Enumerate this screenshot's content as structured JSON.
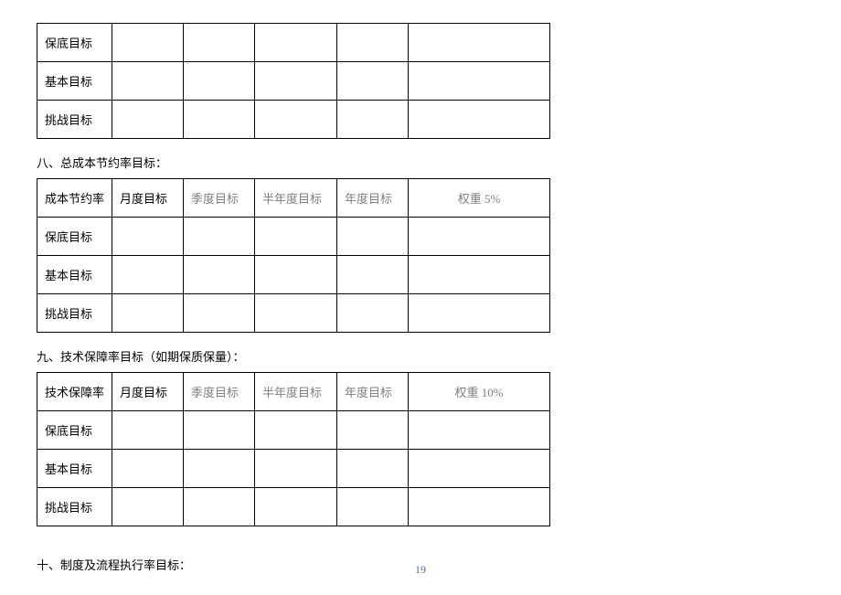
{
  "table1": {
    "rows": [
      {
        "label": "保底目标"
      },
      {
        "label": "基本目标"
      },
      {
        "label": "挑战目标"
      }
    ]
  },
  "section8": {
    "title": "八、总成本节约率目标：",
    "header": {
      "col1": "成本节约率",
      "col2": "月度目标",
      "col3": "季度目标",
      "col4": "半年度目标",
      "col5": "年度目标",
      "col6": "权重 5%"
    },
    "rows": [
      {
        "label": "保底目标"
      },
      {
        "label": "基本目标"
      },
      {
        "label": "挑战目标"
      }
    ]
  },
  "section9": {
    "title": "九、技术保障率目标（如期保质保量）：",
    "header": {
      "col1": "技术保障率",
      "col2": "月度目标",
      "col3": "季度目标",
      "col4": "半年度目标",
      "col5": "年度目标",
      "col6": "权重 10%"
    },
    "rows": [
      {
        "label": "保底目标"
      },
      {
        "label": "基本目标"
      },
      {
        "label": "挑战目标"
      }
    ]
  },
  "section10": {
    "title": "十、制度及流程执行率目标："
  },
  "page_number": "19"
}
